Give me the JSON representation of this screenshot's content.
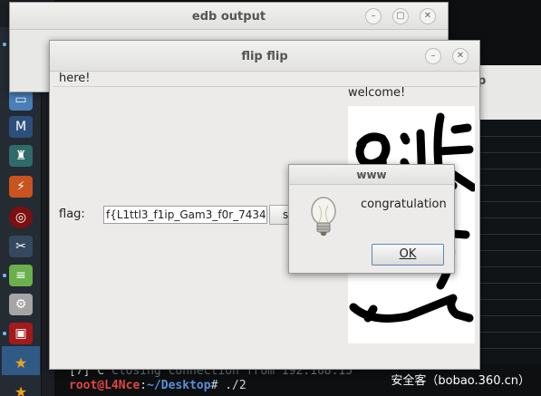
{
  "edb_window": {
    "title": "edb output"
  },
  "flip_window": {
    "title": "flip flip",
    "menu_text": "here!",
    "welcome_text": "welcome!",
    "flag_label": "flag:",
    "flag_value": "f{L1ttl3_f1ip_Gam3_f0r_7434",
    "submit_label": "s"
  },
  "dialog": {
    "title": "www",
    "message": "congratulation",
    "ok_label": "OK",
    "icon": "lightbulb-icon"
  },
  "background_window": {
    "title_fragment": "p"
  },
  "terminal": {
    "line1_prefix": "[7]",
    "line1_text": "^C",
    "line1_faded": "Closing connection from 192.168.15",
    "line2_prompt_user": "root@L4Nce",
    "line2_prompt_sep": ":",
    "line2_prompt_path": "~/Desktop",
    "line2_command": "# ./2"
  },
  "watermark": "安全客（bobao.360.cn）",
  "dock": {
    "items": [
      "browser-icon",
      "terminal-icon",
      "files-icon",
      "metasploit-icon",
      "armitage-icon",
      "burpsuite-icon",
      "target-icon",
      "tools-icon",
      "notes-icon",
      "settings-icon",
      "app-icon",
      "star-icon",
      "star-icon-2"
    ]
  }
}
